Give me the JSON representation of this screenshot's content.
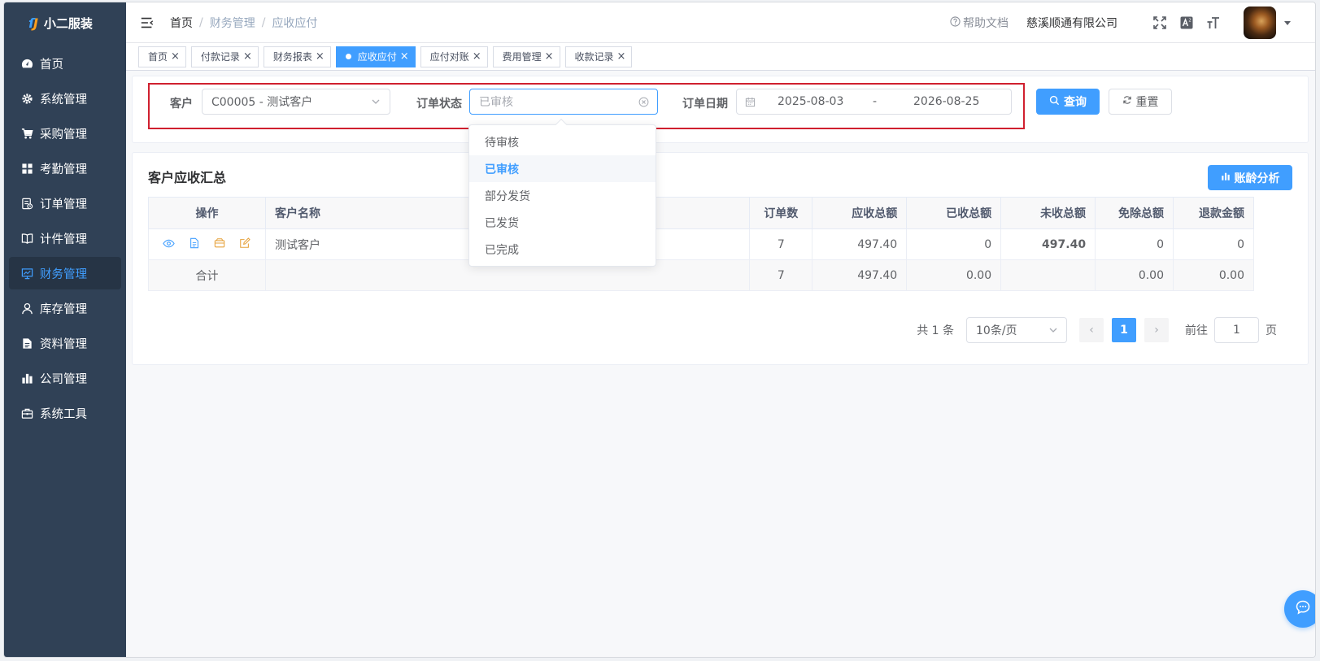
{
  "app": {
    "logo_mark": "ſJ",
    "title": "小二服装"
  },
  "sidebar": {
    "items": [
      {
        "label": "首页",
        "icon": "dashboard-icon"
      },
      {
        "label": "系统管理",
        "icon": "gear-icon"
      },
      {
        "label": "采购管理",
        "icon": "cart-icon"
      },
      {
        "label": "考勤管理",
        "icon": "grid-icon"
      },
      {
        "label": "订单管理",
        "icon": "order-icon"
      },
      {
        "label": "计件管理",
        "icon": "book-icon"
      },
      {
        "label": "财务管理",
        "icon": "monitor-icon",
        "active": true
      },
      {
        "label": "库存管理",
        "icon": "user-icon"
      },
      {
        "label": "资料管理",
        "icon": "document-icon"
      },
      {
        "label": "公司管理",
        "icon": "bar-chart-icon"
      },
      {
        "label": "系统工具",
        "icon": "toolbox-icon"
      }
    ]
  },
  "navbar": {
    "breadcrumb": [
      "首页",
      "财务管理",
      "应收应付"
    ],
    "separator": "/",
    "help_label": "帮助文档",
    "company": "慈溪顺通有限公司"
  },
  "tags": [
    {
      "label": "首页",
      "active": false
    },
    {
      "label": "付款记录",
      "active": false
    },
    {
      "label": "财务报表",
      "active": false
    },
    {
      "label": "应收应付",
      "active": true
    },
    {
      "label": "应付对账",
      "active": false
    },
    {
      "label": "费用管理",
      "active": false
    },
    {
      "label": "收款记录",
      "active": false
    }
  ],
  "filters": {
    "customer_label": "客户",
    "customer_value": "C00005 - 测试客户",
    "status_label": "订单状态",
    "status_placeholder": "已审核",
    "date_label": "订单日期",
    "date_start": "2025-08-03",
    "date_sep": "-",
    "date_end": "2026-08-25",
    "search_label": "查询",
    "reset_label": "重置"
  },
  "status_dropdown": {
    "options": [
      "待审核",
      "已审核",
      "部分发货",
      "已发货",
      "已完成"
    ],
    "selected": "已审核"
  },
  "summary": {
    "title": "客户应收汇总",
    "analysis_label": "账龄分析",
    "columns": [
      "操作",
      "客户名称",
      "订单数",
      "应收总额",
      "已收总额",
      "未收总额",
      "免除总额",
      "退款金额"
    ],
    "rows": [
      {
        "customer": "测试客户",
        "orders": "7",
        "receivable": "497.40",
        "received": "0",
        "unreceived": "497.40",
        "waived": "0",
        "refund": "0"
      }
    ],
    "total": {
      "label": "合计",
      "orders": "7",
      "receivable": "497.40",
      "received": "0.00",
      "unreceived": "",
      "waived": "0.00",
      "refund": "0.00"
    }
  },
  "pagination": {
    "total_text": "共 1 条",
    "page_size": "10条/页",
    "current_page": "1",
    "goto_label": "前往",
    "goto_value": "1",
    "page_suffix": "页",
    "prev": "‹",
    "next": "›"
  },
  "colors": {
    "sidebar_bg": "#304156",
    "primary": "#409eff",
    "danger": "#f56c6c",
    "success": "#67c23a",
    "warning": "#e6a23c",
    "highlight_border": "#d0202f"
  }
}
